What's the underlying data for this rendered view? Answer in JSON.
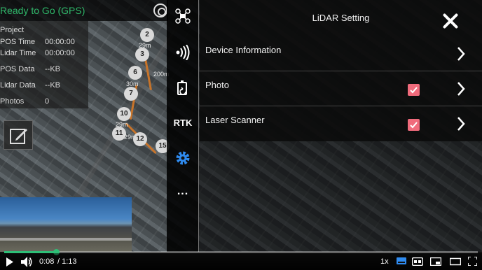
{
  "gps_status": "Ready to Go (GPS)",
  "info_panel": {
    "rows": [
      {
        "label": "Project",
        "value": ""
      },
      {
        "label": "POS Time",
        "value": "00:00:00"
      },
      {
        "label": "Lidar Time",
        "value": "00:00:00"
      },
      {
        "label": "POS Data",
        "value": "--KB"
      },
      {
        "label": "Lidar Data",
        "value": "--KB"
      },
      {
        "label": "Photos",
        "value": "0"
      }
    ]
  },
  "waypoints": {
    "labels": [
      "2",
      "3",
      "6",
      "7",
      "10",
      "11",
      "12",
      "15"
    ],
    "distances": [
      "29m",
      "200m",
      "30m",
      "29m",
      "29m"
    ]
  },
  "icon_bar": {
    "items": [
      {
        "icon": "drone-icon"
      },
      {
        "icon": "lidar-signal-icon"
      },
      {
        "icon": "battery-icon"
      },
      {
        "icon": "rtk-text",
        "label": "RTK"
      },
      {
        "icon": "gear-icon"
      },
      {
        "icon": "more-icon",
        "label": "..."
      }
    ]
  },
  "settings_panel": {
    "title": "LiDAR Setting",
    "rows": [
      {
        "label": "Device Information",
        "checked": false
      },
      {
        "label": "Photo",
        "checked": true
      },
      {
        "label": "Laser Scanner",
        "checked": true
      }
    ]
  },
  "colors": {
    "accent_green": "#2ebf77",
    "checkbox_pink": "#f06b7c",
    "route_orange": "#c8742a"
  },
  "video": {
    "current_time": "0:08",
    "total_time": "/ 1:13",
    "speed": "1x",
    "progress": 0.11
  }
}
